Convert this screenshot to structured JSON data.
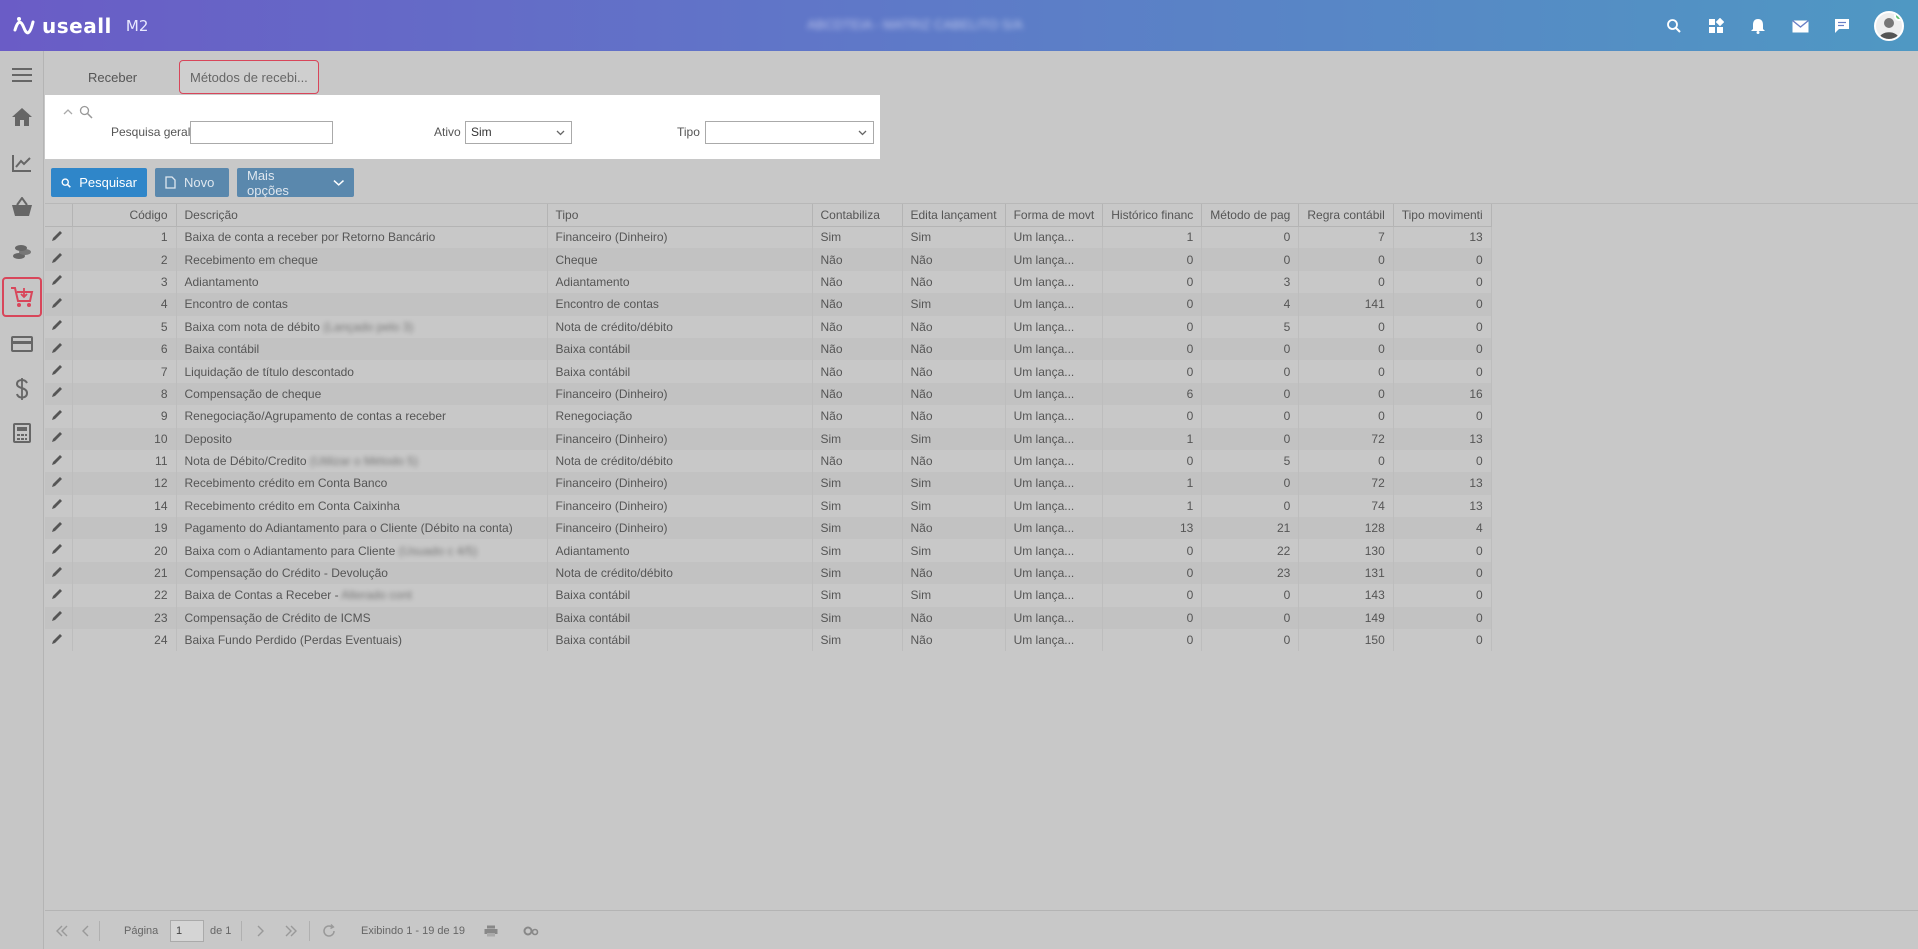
{
  "header": {
    "logo_text": "useall",
    "logo_version": "M2",
    "company_name": "ABCDTEIA - MATRIZ CABELITO S/A",
    "icons": [
      "search-icon",
      "apps-icon",
      "bell-icon",
      "mail-icon",
      "chat-icon",
      "user-avatar"
    ]
  },
  "sidebar": {
    "items": [
      "menu-icon",
      "home-icon",
      "chart-icon",
      "basket-icon",
      "coins-icon",
      "cart-receive-icon",
      "card-icon",
      "dollar-icon",
      "calculator-icon"
    ],
    "active": "cart-receive-icon"
  },
  "tabs": [
    {
      "label": "Receber"
    },
    {
      "label": "Métodos de recebi..."
    }
  ],
  "filter": {
    "general_label": "Pesquisa geral",
    "general_value": "",
    "active_label": "Ativo",
    "active_value": "Sim",
    "type_label": "Tipo",
    "type_value": ""
  },
  "actions": {
    "search": "Pesquisar",
    "new": "Novo",
    "more": "Mais opções"
  },
  "table": {
    "columns": [
      "Código",
      "Descrição",
      "Tipo",
      "Contabiliza",
      "Edita lançament",
      "Forma de movt",
      "Histórico financ",
      "Método de pag",
      "Regra contábil",
      "Tipo movimenti"
    ],
    "rows": [
      {
        "code": "1",
        "desc": "Baixa de conta a receber por Retorno Bancário",
        "blur": "",
        "type": "Financeiro (Dinheiro)",
        "cont": "Sim",
        "edit": "Sim",
        "forma": "Um lança...",
        "hist": "1",
        "met": "0",
        "regra": "7",
        "tmov": "13"
      },
      {
        "code": "2",
        "desc": "Recebimento em cheque",
        "blur": "",
        "type": "Cheque",
        "cont": "Não",
        "edit": "Não",
        "forma": "Um lança...",
        "hist": "0",
        "met": "0",
        "regra": "0",
        "tmov": "0"
      },
      {
        "code": "3",
        "desc": "Adiantamento",
        "blur": "",
        "type": "Adiantamento",
        "cont": "Não",
        "edit": "Não",
        "forma": "Um lança...",
        "hist": "0",
        "met": "3",
        "regra": "0",
        "tmov": "0"
      },
      {
        "code": "4",
        "desc": "Encontro de contas",
        "blur": "",
        "type": "Encontro de contas",
        "cont": "Não",
        "edit": "Sim",
        "forma": "Um lança...",
        "hist": "0",
        "met": "4",
        "regra": "141",
        "tmov": "0"
      },
      {
        "code": "5",
        "desc": "Baixa com nota de débito",
        "blur": "(Lançado pelo 3)",
        "type": "Nota de crédito/débito",
        "cont": "Não",
        "edit": "Não",
        "forma": "Um lança...",
        "hist": "0",
        "met": "5",
        "regra": "0",
        "tmov": "0"
      },
      {
        "code": "6",
        "desc": "Baixa contábil",
        "blur": "",
        "type": "Baixa contábil",
        "cont": "Não",
        "edit": "Não",
        "forma": "Um lança...",
        "hist": "0",
        "met": "0",
        "regra": "0",
        "tmov": "0"
      },
      {
        "code": "7",
        "desc": "Liquidação de título descontado",
        "blur": "",
        "type": "Baixa contábil",
        "cont": "Não",
        "edit": "Não",
        "forma": "Um lança...",
        "hist": "0",
        "met": "0",
        "regra": "0",
        "tmov": "0"
      },
      {
        "code": "8",
        "desc": "Compensação de cheque",
        "blur": "",
        "type": "Financeiro (Dinheiro)",
        "cont": "Não",
        "edit": "Não",
        "forma": "Um lança...",
        "hist": "6",
        "met": "0",
        "regra": "0",
        "tmov": "16"
      },
      {
        "code": "9",
        "desc": "Renegociação/Agrupamento de contas a receber",
        "blur": "",
        "type": "Renegociação",
        "cont": "Não",
        "edit": "Não",
        "forma": "Um lança...",
        "hist": "0",
        "met": "0",
        "regra": "0",
        "tmov": "0"
      },
      {
        "code": "10",
        "desc": "Deposito",
        "blur": "",
        "type": "Financeiro (Dinheiro)",
        "cont": "Sim",
        "edit": "Sim",
        "forma": "Um lança...",
        "hist": "1",
        "met": "0",
        "regra": "72",
        "tmov": "13"
      },
      {
        "code": "11",
        "desc": "Nota de Débito/Credito",
        "blur": "(Utilizar o Método 5)",
        "type": "Nota de crédito/débito",
        "cont": "Não",
        "edit": "Não",
        "forma": "Um lança...",
        "hist": "0",
        "met": "5",
        "regra": "0",
        "tmov": "0"
      },
      {
        "code": "12",
        "desc": "Recebimento crédito em Conta Banco",
        "blur": "",
        "type": "Financeiro (Dinheiro)",
        "cont": "Sim",
        "edit": "Sim",
        "forma": "Um lança...",
        "hist": "1",
        "met": "0",
        "regra": "72",
        "tmov": "13"
      },
      {
        "code": "14",
        "desc": "Recebimento crédito em Conta Caixinha",
        "blur": "",
        "type": "Financeiro (Dinheiro)",
        "cont": "Sim",
        "edit": "Sim",
        "forma": "Um lança...",
        "hist": "1",
        "met": "0",
        "regra": "74",
        "tmov": "13"
      },
      {
        "code": "19",
        "desc": "Pagamento do Adiantamento para o Cliente (Débito na conta)",
        "blur": "",
        "type": "Financeiro (Dinheiro)",
        "cont": "Sim",
        "edit": "Não",
        "forma": "Um lança...",
        "hist": "13",
        "met": "21",
        "regra": "128",
        "tmov": "4"
      },
      {
        "code": "20",
        "desc": "Baixa com o Adiantamento para Cliente",
        "blur": "(Usuado c 4/5)",
        "type": "Adiantamento",
        "cont": "Sim",
        "edit": "Sim",
        "forma": "Um lança...",
        "hist": "0",
        "met": "22",
        "regra": "130",
        "tmov": "0"
      },
      {
        "code": "21",
        "desc": "Compensação do Crédito - Devolução",
        "blur": "",
        "type": "Nota de crédito/débito",
        "cont": "Sim",
        "edit": "Não",
        "forma": "Um lança...",
        "hist": "0",
        "met": "23",
        "regra": "131",
        "tmov": "0"
      },
      {
        "code": "22",
        "desc": "Baixa de Contas a Receber -",
        "blur": "Alterado cont",
        "type": "Baixa contábil",
        "cont": "Sim",
        "edit": "Sim",
        "forma": "Um lança...",
        "hist": "0",
        "met": "0",
        "regra": "143",
        "tmov": "0"
      },
      {
        "code": "23",
        "desc": "Compensação de Crédito de ICMS",
        "blur": "",
        "type": "Baixa contábil",
        "cont": "Sim",
        "edit": "Não",
        "forma": "Um lança...",
        "hist": "0",
        "met": "0",
        "regra": "149",
        "tmov": "0"
      },
      {
        "code": "24",
        "desc": "Baixa Fundo Perdido (Perdas Eventuais)",
        "blur": "",
        "type": "Baixa contábil",
        "cont": "Sim",
        "edit": "Não",
        "forma": "Um lança...",
        "hist": "0",
        "met": "0",
        "regra": "150",
        "tmov": "0"
      }
    ]
  },
  "pager": {
    "page_label": "Página",
    "page_value": "1",
    "of_label": "de 1",
    "showing": "Exibindo 1 - 19 de 19"
  }
}
